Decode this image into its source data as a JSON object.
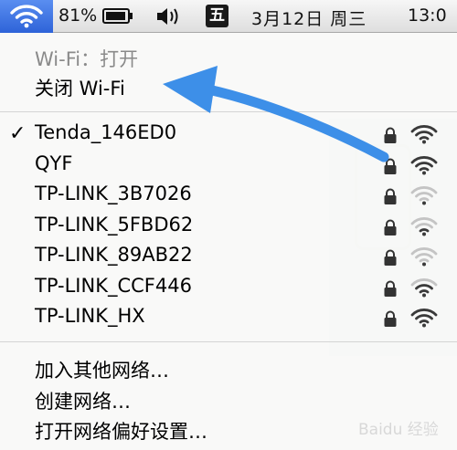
{
  "menubar": {
    "battery_percent": "81%",
    "input_method": "五",
    "date": "3月12日 周三",
    "time": "13:0",
    "wifi_icon": "wifi-icon",
    "battery_icon": "battery-icon",
    "volume_icon": "speaker-volume-icon"
  },
  "wifi_menu": {
    "status": "Wi-Fi：打开",
    "toggle_label": "关闭 Wi-Fi",
    "networks": [
      {
        "ssid": "Tenda_146ED0",
        "connected": true,
        "locked": true,
        "signal": 1.0
      },
      {
        "ssid": "QYF",
        "connected": false,
        "locked": true,
        "signal": 1.0
      },
      {
        "ssid": "TP-LINK_3B7026",
        "connected": false,
        "locked": true,
        "signal": 0.25
      },
      {
        "ssid": "TP-LINK_5FBD62",
        "connected": false,
        "locked": true,
        "signal": 0.5
      },
      {
        "ssid": "TP-LINK_89AB22",
        "connected": false,
        "locked": true,
        "signal": 0.25
      },
      {
        "ssid": "TP-LINK_CCF446",
        "connected": false,
        "locked": true,
        "signal": 0.75
      },
      {
        "ssid": "TP-LINK_HX",
        "connected": false,
        "locked": true,
        "signal": 1.0
      }
    ],
    "checkmark": "✓",
    "join_other": "加入其他网络…",
    "create_network": "创建网络…",
    "open_preferences": "打开网络偏好设置…"
  },
  "watermark_text": "Baidu 经验",
  "colors": {
    "menu_highlight": "#2e63d8",
    "annotation_arrow": "#3d8fe8",
    "signal_active": "#3a3a3a",
    "signal_inactive": "#c4c4c4",
    "status_text": "#8a8a8a"
  }
}
